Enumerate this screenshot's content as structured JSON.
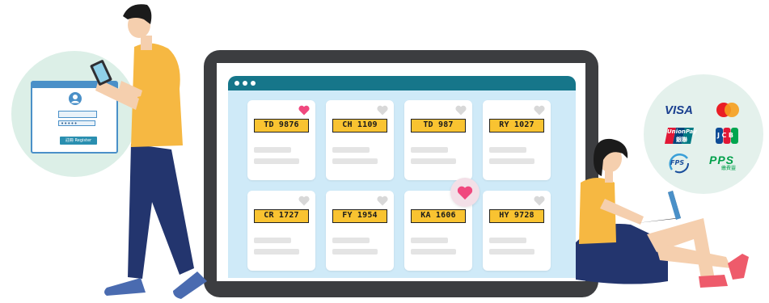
{
  "login_dialog": {
    "password_mask": "•••••",
    "register_label": "註冊 Register"
  },
  "plates": [
    {
      "number": "TD 9876",
      "favorited": true
    },
    {
      "number": "CH 1109",
      "favorited": false
    },
    {
      "number": "TD 987",
      "favorited": false
    },
    {
      "number": "RY 1027",
      "favorited": false
    },
    {
      "number": "CR 1727",
      "favorited": false
    },
    {
      "number": "FY 1954",
      "favorited": false
    },
    {
      "number": "KA 1606",
      "favorited": false
    },
    {
      "number": "HY 9728",
      "favorited": false
    }
  ],
  "payment_methods": {
    "visa": "VISA",
    "mastercard": "mastercard",
    "unionpay_en": "UnionPay",
    "unionpay_cn": "銀聯",
    "jcb": "JCB",
    "fps": "FPS",
    "pps": "PPS",
    "pps_cn": "繳費靈"
  },
  "colors": {
    "accent_teal": "#16768a",
    "plate_yellow": "#f9c331",
    "heart_pink": "#f0487e",
    "heart_inactive": "#d8d8d8",
    "card_bg": "#cfeaf8"
  }
}
